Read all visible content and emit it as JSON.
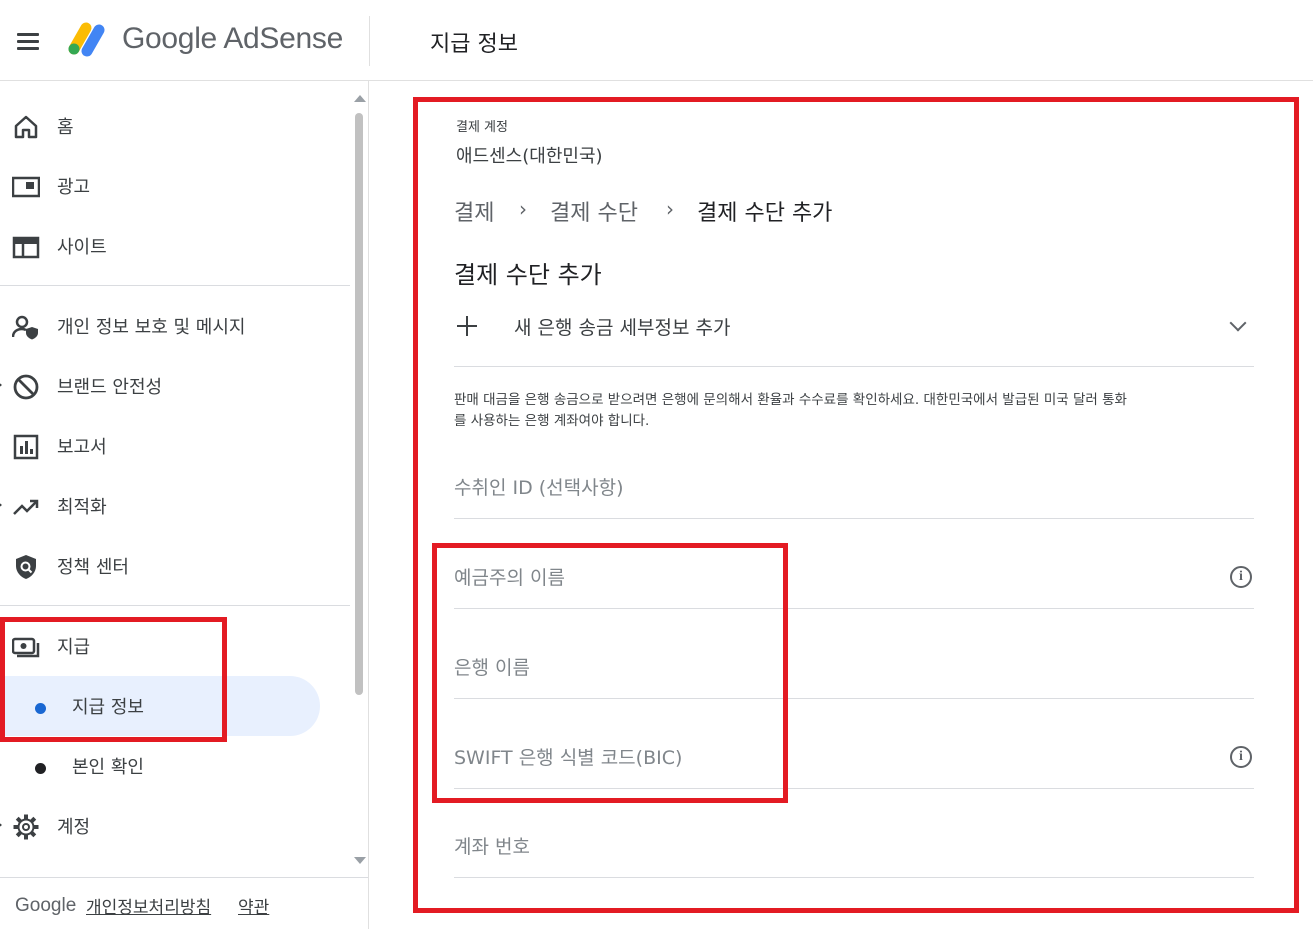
{
  "header": {
    "brand": "Google AdSense",
    "page_title": "지급 정보"
  },
  "sidebar": {
    "items": [
      {
        "label": "홈",
        "icon": "home-icon"
      },
      {
        "label": "광고",
        "icon": "ads-icon"
      },
      {
        "label": "사이트",
        "icon": "sites-icon"
      },
      {
        "label": "개인 정보 보호 및 메시지",
        "icon": "privacy-messaging-icon"
      },
      {
        "label": "브랜드 안전성",
        "icon": "block-icon"
      },
      {
        "label": "보고서",
        "icon": "reports-icon"
      },
      {
        "label": "최적화",
        "icon": "trending-up-icon"
      },
      {
        "label": "정책 센터",
        "icon": "policy-shield-icon"
      },
      {
        "label": "지급",
        "icon": "payments-icon"
      },
      {
        "label": "계정",
        "icon": "gear-icon"
      }
    ],
    "payments_subitems": [
      {
        "label": "지급 정보",
        "active": true
      },
      {
        "label": "본인 확인",
        "active": false
      }
    ],
    "footer": {
      "google": "Google",
      "privacy": "개인정보처리방침",
      "terms": "약관"
    }
  },
  "main": {
    "account_caption": "결제 계정",
    "account_name": "애드센스(대한민국)",
    "breadcrumb": [
      "결제",
      "결제 수단",
      "결제 수단 추가"
    ],
    "section_title": "결제 수단 추가",
    "expander_label": "새 은행 송금 세부정보 추가",
    "notice_line1": "판매 대금을 은행 송금으로 받으려면 은행에 문의해서 환율과 수수료를 확인하세요. 대한민국에서 발급된 미국 달러 통화",
    "notice_line2": "를 사용하는 은행 계좌여야 합니다.",
    "fields": {
      "payee_id": "수취인 ID (선택사항)",
      "account_holder": "예금주의 이름",
      "bank_name": "은행 이름",
      "swift": "SWIFT 은행 식별 코드(BIC)",
      "account_number": "계좌 번호"
    }
  },
  "colors": {
    "annotation_red": "#e31b23",
    "active_blue": "#1967d2",
    "active_bg": "#e8f0fe"
  }
}
